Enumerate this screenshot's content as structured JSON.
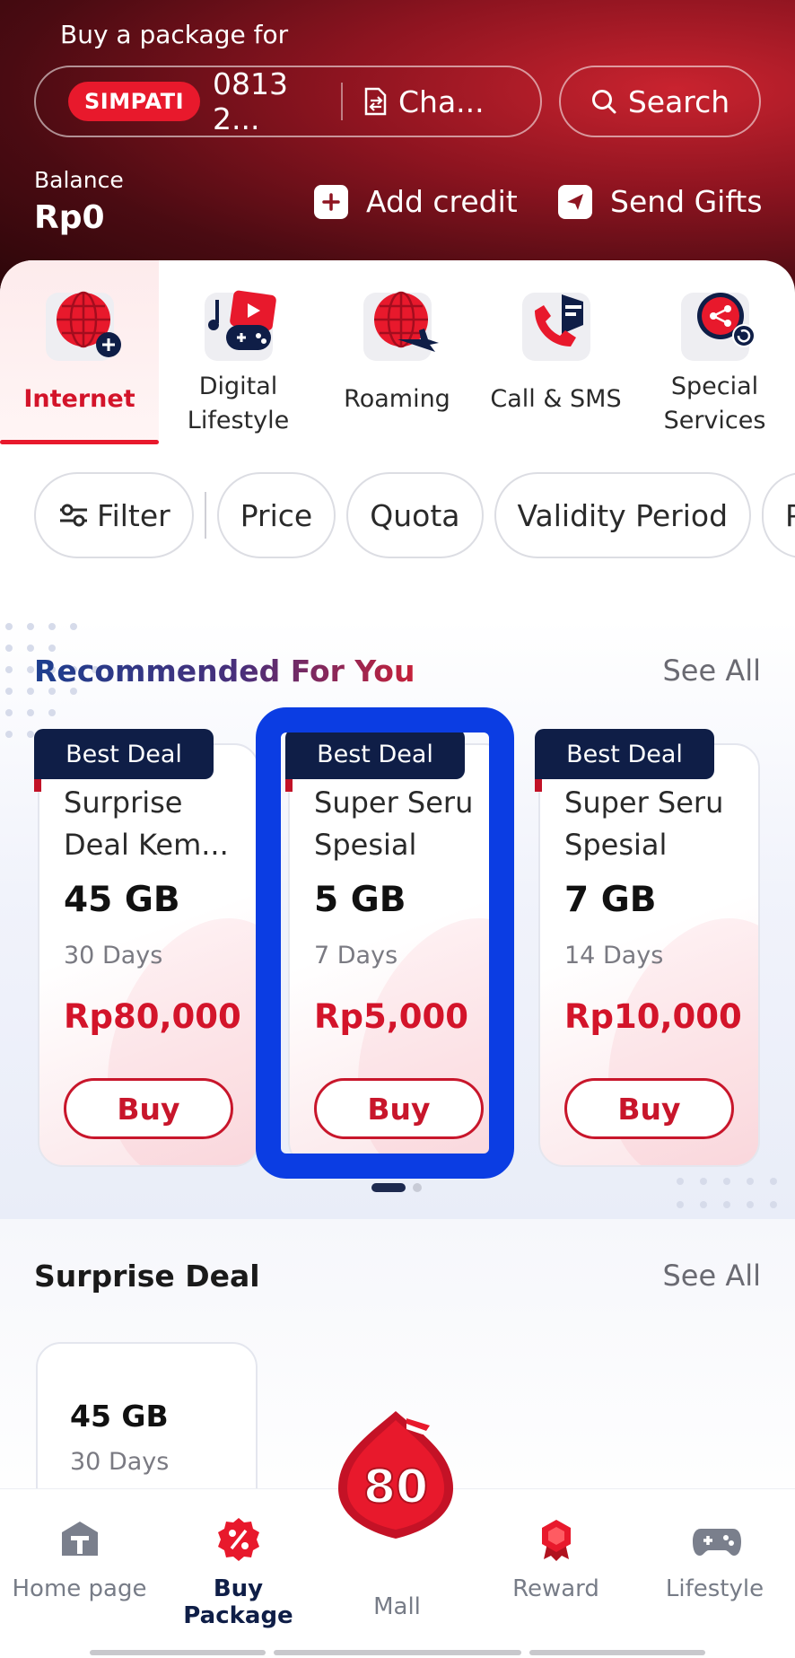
{
  "header": {
    "title": "Buy a package for",
    "operator_badge": "SIMPATI",
    "phone_number": "0813 2...",
    "change_label": "Cha...",
    "search_label": "Search",
    "balance_label": "Balance",
    "balance_value": "Rp0",
    "add_credit_label": "Add credit",
    "send_gifts_label": "Send Gifts"
  },
  "categories": [
    {
      "label": "Internet",
      "icon": "globe-plus-icon",
      "active": true
    },
    {
      "label": "Digital\nLifestyle",
      "icon": "media-gamepad-icon",
      "active": false
    },
    {
      "label": "Roaming",
      "icon": "globe-plane-icon",
      "active": false
    },
    {
      "label": "Call & SMS",
      "icon": "phone-message-icon",
      "active": false
    },
    {
      "label": "Special\nServices",
      "icon": "share-refresh-icon",
      "active": false
    }
  ],
  "filters": {
    "filter_label": "Filter",
    "chips": [
      "Price",
      "Quota",
      "Validity Period",
      "Po"
    ]
  },
  "recommended": {
    "title": "Recommended For You",
    "see_all": "See All",
    "cards": [
      {
        "badge": "Best Deal",
        "name": "Surprise\nDeal Kem...",
        "quota": "45 GB",
        "validity": "30 Days",
        "price": "Rp80,000",
        "buy_label": "Buy"
      },
      {
        "badge": "Best Deal",
        "name": "Super Seru\nSpesial",
        "quota": "5 GB",
        "validity": "7 Days",
        "price": "Rp5,000",
        "buy_label": "Buy"
      },
      {
        "badge": "Best Deal",
        "name": "Super Seru\nSpesial",
        "quota": "7 GB",
        "validity": "14 Days",
        "price": "Rp10,000",
        "buy_label": "Buy"
      }
    ]
  },
  "surprise_deal": {
    "title": "Surprise Deal",
    "see_all": "See All",
    "card": {
      "quota": "45 GB",
      "validity": "30 Days"
    }
  },
  "bottom_nav": {
    "items": [
      {
        "label": "Home page",
        "icon": "home-icon",
        "active": false
      },
      {
        "label": "Buy Package",
        "icon": "percent-badge-icon",
        "active": true
      },
      {
        "label": "Mall",
        "icon": "mall-80-badge-icon",
        "active": false
      },
      {
        "label": "Reward",
        "icon": "reward-ribbon-icon",
        "active": false
      },
      {
        "label": "Lifestyle",
        "icon": "gamepad-icon",
        "active": false
      }
    ],
    "mall_badge_text": "80"
  },
  "colors": {
    "brand_red": "#e8192c",
    "price_red": "#d3142a",
    "navy": "#0f1e47",
    "highlight_blue": "#0b3de3"
  }
}
